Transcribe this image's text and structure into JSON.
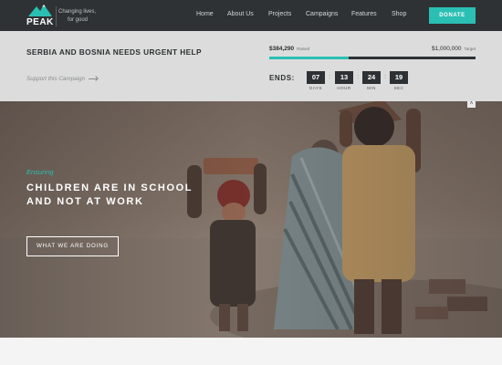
{
  "header": {
    "logo_text": "PEAK",
    "tagline_line1": "Changing lives,",
    "tagline_line2": "for good",
    "nav": [
      "Home",
      "About Us",
      "Projects",
      "Campaigns",
      "Features",
      "Shop"
    ],
    "donate_label": "DONATE",
    "colors": {
      "bar": "#2f3234",
      "accent": "#2bbfb4"
    }
  },
  "campaign": {
    "title": "SERBIA AND BOSNIA NEEDS URGENT HELP",
    "link_label": "Support this Campaign",
    "raised_amount": "$384,290",
    "raised_label": "Raised",
    "target_amount": "$1,000,000",
    "target_label": "Target",
    "progress_fraction": 0.3843,
    "ends_label": "ENDS:",
    "countdown": [
      {
        "value": "07",
        "unit": "DAYS"
      },
      {
        "value": "13",
        "unit": "HOUR"
      },
      {
        "value": "24",
        "unit": "MIN"
      },
      {
        "value": "19",
        "unit": "SEC"
      }
    ]
  },
  "hero": {
    "eyebrow": "Ensuring",
    "title": "CHILDREN ARE IN SCHOOL AND NOT AT WORK",
    "button_label": "WHAT WE ARE DOING",
    "scroll_icon": "chevron-up-icon"
  }
}
